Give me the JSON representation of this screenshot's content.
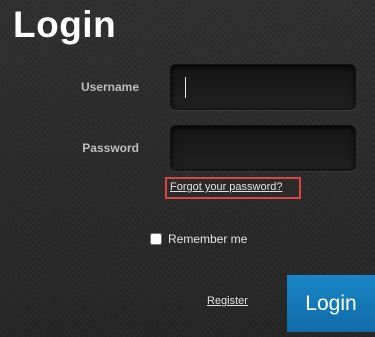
{
  "page": {
    "title": "Login"
  },
  "form": {
    "username_label": "Username",
    "username_value": "",
    "password_label": "Password",
    "password_value": "",
    "forgot_password_text": "Forgot your password?",
    "remember_me_label": "Remember me",
    "remember_me_checked": false,
    "register_text": "Register",
    "login_button_label": "Login"
  },
  "colors": {
    "background": "#2b2b2b",
    "button_blue": "#1a86c6",
    "highlight_red": "#d8453c",
    "label_gray": "#bdbdbd"
  }
}
